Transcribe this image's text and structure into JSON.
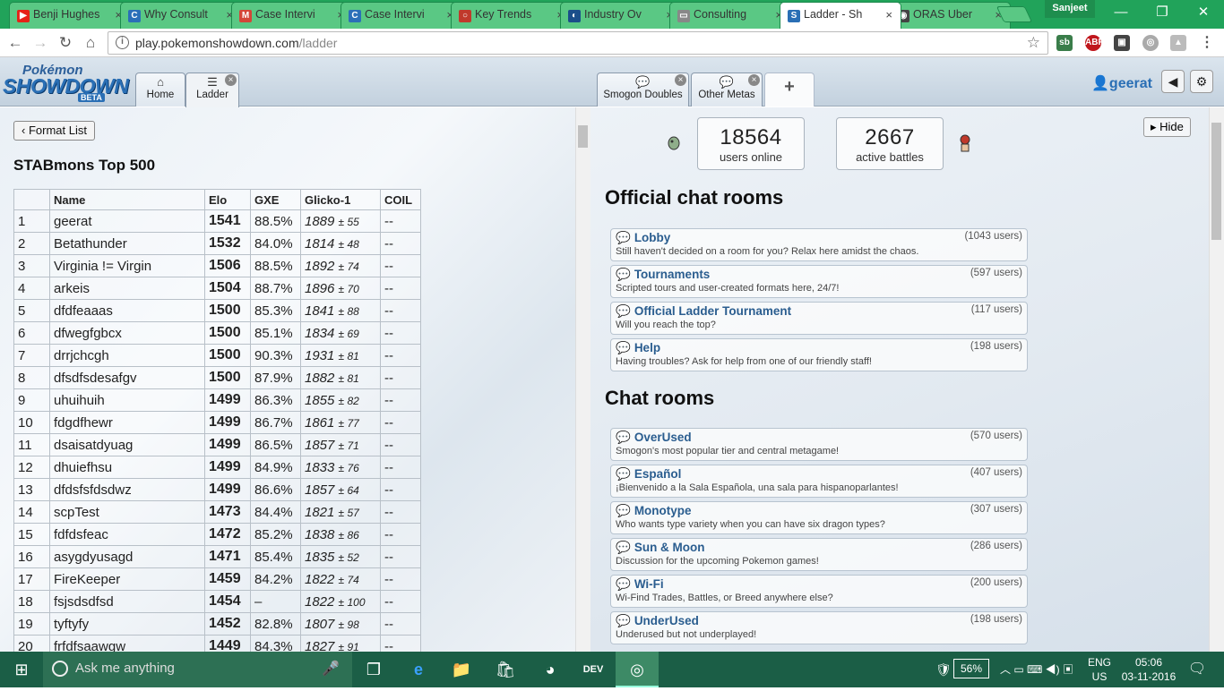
{
  "browser": {
    "tabs": [
      {
        "title": "Benji Hughes",
        "fav": "▶",
        "favcolor": "#e62117"
      },
      {
        "title": "Why Consult",
        "fav": "C",
        "favcolor": "#2b6fb8"
      },
      {
        "title": "Case Intervi",
        "fav": "M",
        "favcolor": "#d44638"
      },
      {
        "title": "Case Intervi",
        "fav": "C",
        "favcolor": "#2b6fb8"
      },
      {
        "title": "Key Trends",
        "fav": "○",
        "favcolor": "#c0392b"
      },
      {
        "title": "Industry Ov",
        "fav": "◐",
        "favcolor": "#1a4e8a"
      },
      {
        "title": "Consulting",
        "fav": "▭",
        "favcolor": "#888888"
      },
      {
        "title": "Ladder - Sh",
        "fav": "S",
        "favcolor": "#2a6fb5"
      },
      {
        "title": "ORAS Uber",
        "fav": "◉",
        "favcolor": "#444444"
      }
    ],
    "profile": "Sanjeet",
    "url_host": "play.pokemonshowdown.com",
    "url_path": "/ladder"
  },
  "showdown": {
    "logo_top": "Pokémon",
    "logo_main": "SHOWDOWN",
    "logo_beta": "BETA",
    "tabs": [
      {
        "label": "Home"
      },
      {
        "label": "Ladder"
      },
      {
        "label": "Smogon Doubles"
      },
      {
        "label": "Other Metas"
      }
    ],
    "plus": "+",
    "username": "geerat"
  },
  "ladder": {
    "format_button": "Format List",
    "title": "STABmons Top 500",
    "columns": [
      "",
      "Name",
      "Elo",
      "GXE",
      "Glicko-1",
      "COIL"
    ],
    "rows": [
      [
        "1",
        "geerat",
        "1541",
        "88.5%",
        "1889",
        "± 55",
        "--"
      ],
      [
        "2",
        "Betathunder",
        "1532",
        "84.0%",
        "1814",
        "± 48",
        "--"
      ],
      [
        "3",
        "Virginia != Virgin",
        "1506",
        "88.5%",
        "1892",
        "± 74",
        "--"
      ],
      [
        "4",
        "arkeis",
        "1504",
        "88.7%",
        "1896",
        "± 70",
        "--"
      ],
      [
        "5",
        "dfdfeaaas",
        "1500",
        "85.3%",
        "1841",
        "± 88",
        "--"
      ],
      [
        "6",
        "dfwegfgbcx",
        "1500",
        "85.1%",
        "1834",
        "± 69",
        "--"
      ],
      [
        "7",
        "drrjchcgh",
        "1500",
        "90.3%",
        "1931",
        "± 81",
        "--"
      ],
      [
        "8",
        "dfsdfsdesafgv",
        "1500",
        "87.9%",
        "1882",
        "± 81",
        "--"
      ],
      [
        "9",
        "uhuihuih",
        "1499",
        "86.3%",
        "1855",
        "± 82",
        "--"
      ],
      [
        "10",
        "fdgdfhewr",
        "1499",
        "86.7%",
        "1861",
        "± 77",
        "--"
      ],
      [
        "11",
        "dsaisatdyuag",
        "1499",
        "86.5%",
        "1857",
        "± 71",
        "--"
      ],
      [
        "12",
        "dhuiefhsu",
        "1499",
        "84.9%",
        "1833",
        "± 76",
        "--"
      ],
      [
        "13",
        "dfdsfsfdsdwz",
        "1499",
        "86.6%",
        "1857",
        "± 64",
        "--"
      ],
      [
        "14",
        "scpTest",
        "1473",
        "84.4%",
        "1821",
        "± 57",
        "--"
      ],
      [
        "15",
        "fdfdsfeac",
        "1472",
        "85.2%",
        "1838",
        "± 86",
        "--"
      ],
      [
        "16",
        "asygdyusagd",
        "1471",
        "85.4%",
        "1835",
        "± 52",
        "--"
      ],
      [
        "17",
        "FireKeeper",
        "1459",
        "84.2%",
        "1822",
        "± 74",
        "--"
      ],
      [
        "18",
        "fsjsdsdfsd",
        "1454",
        "–",
        "1822",
        "± 100",
        "--"
      ],
      [
        "19",
        "tyftyfy",
        "1452",
        "82.8%",
        "1807",
        "± 98",
        "--"
      ],
      [
        "20",
        "frfdfsaawgw",
        "1449",
        "84.3%",
        "1827",
        "± 91",
        "--"
      ]
    ]
  },
  "mainmenu": {
    "hide": "Hide",
    "users_online": "18564",
    "users_online_label": "users online",
    "active_battles": "2667",
    "active_battles_label": "active battles",
    "official_title": "Official chat rooms",
    "official_rooms": [
      {
        "name": "Lobby",
        "users": "(1043 users)",
        "desc": "Still haven't decided on a room for you? Relax here amidst the chaos."
      },
      {
        "name": "Tournaments",
        "users": "(597 users)",
        "desc": "Scripted tours and user-created formats here, 24/7!"
      },
      {
        "name": "Official Ladder Tournament",
        "users": "(117 users)",
        "desc": "Will you reach the top?"
      },
      {
        "name": "Help",
        "users": "(198 users)",
        "desc": "Having troubles? Ask for help from one of our friendly staff!"
      }
    ],
    "chat_title": "Chat rooms",
    "chat_rooms": [
      {
        "name": "OverUsed",
        "users": "(570 users)",
        "desc": "Smogon's most popular tier and central metagame!"
      },
      {
        "name": "Español",
        "users": "(407 users)",
        "desc": "¡Bienvenido a la Sala Española, una sala para hispanoparlantes!"
      },
      {
        "name": "Monotype",
        "users": "(307 users)",
        "desc": "Who wants type variety when you can have six dragon types?"
      },
      {
        "name": "Sun & Moon",
        "users": "(286 users)",
        "desc": "Discussion for the upcoming Pokemon games!"
      },
      {
        "name": "Wi-Fi",
        "users": "(200 users)",
        "desc": "Wi-Find Trades, Battles, or Breed anywhere else?"
      },
      {
        "name": "UnderUsed",
        "users": "(198 users)",
        "desc": "Underused but not underplayed!"
      }
    ]
  },
  "taskbar": {
    "search_placeholder": "Ask me anything",
    "battery": "56%",
    "lang1": "ENG",
    "lang2": "US",
    "time": "05:06",
    "date": "03-11-2016"
  }
}
